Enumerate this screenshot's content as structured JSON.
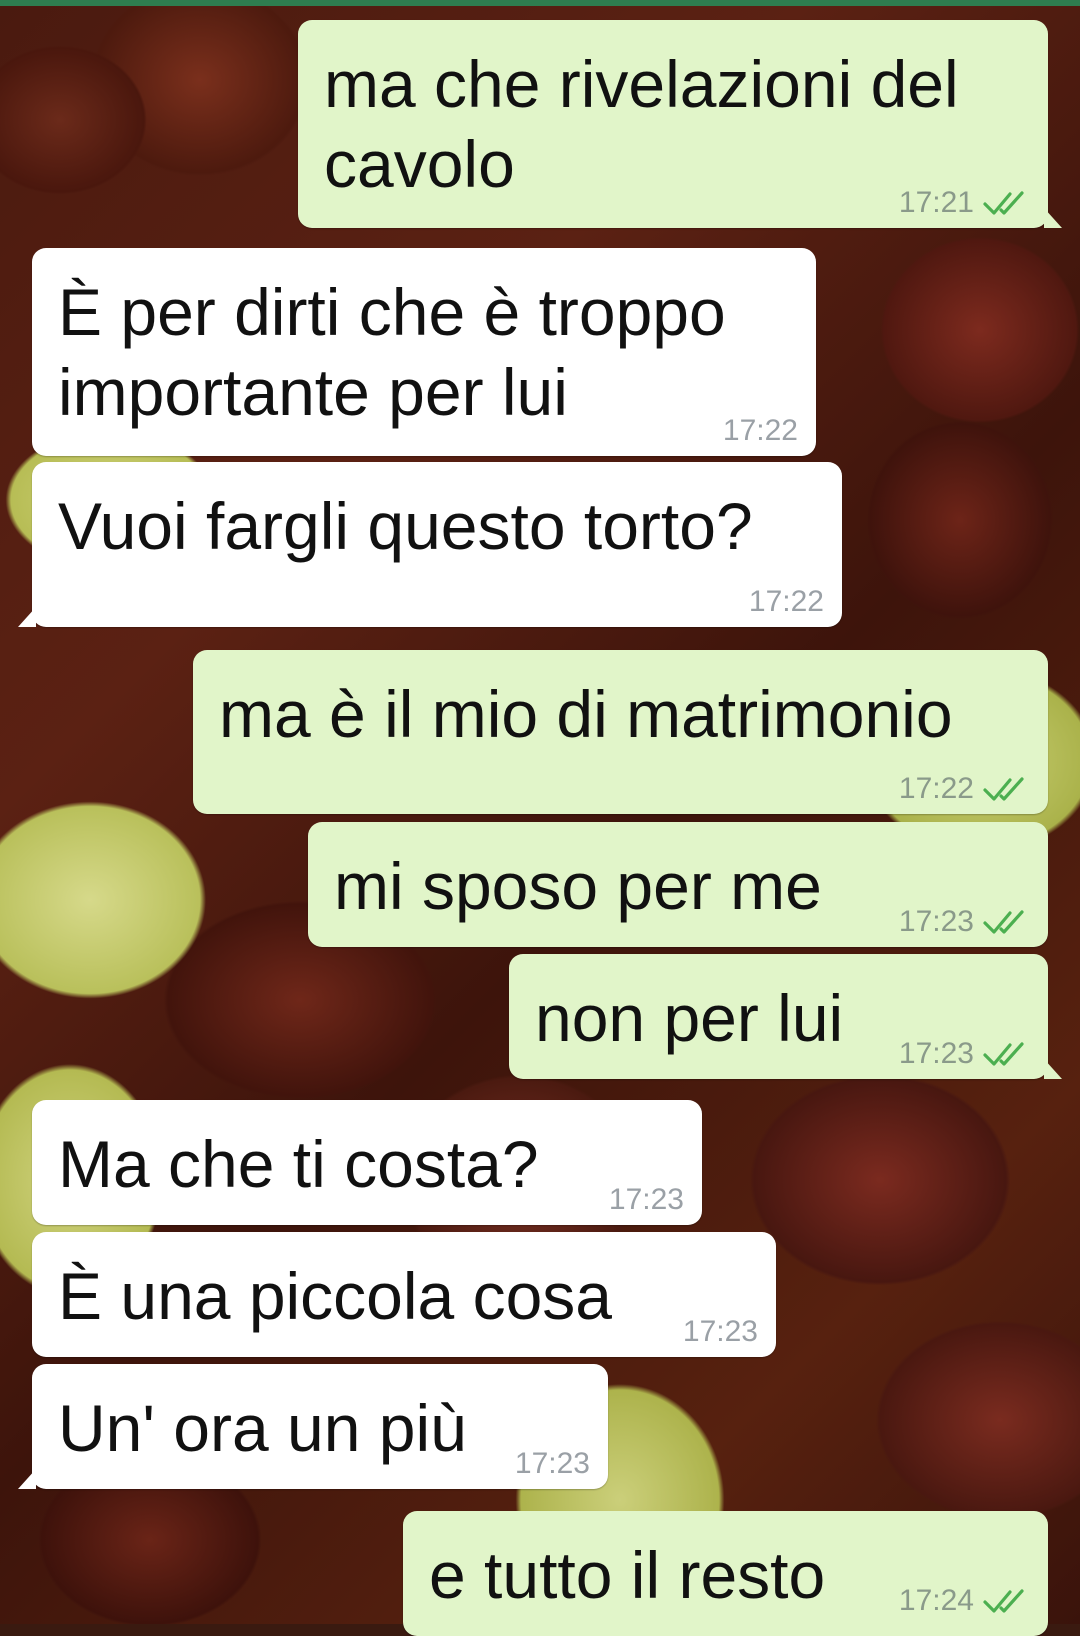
{
  "colors": {
    "outgoing_bubble": "#e1f5c9",
    "incoming_bubble": "#ffffff",
    "read_ticks": "#4caf50",
    "top_strip": "#2e7d4f"
  },
  "icons": {
    "read_status": "double-check-icon"
  },
  "messages": [
    {
      "direction": "outgoing",
      "text": "ma che rivelazioni del\ncavolo",
      "time": "17:21",
      "status": "read"
    },
    {
      "direction": "incoming",
      "text": "È per dirti che è troppo\nimportante per lui",
      "time": "17:22"
    },
    {
      "direction": "incoming",
      "text": "Vuoi fargli questo torto?",
      "time": "17:22"
    },
    {
      "direction": "outgoing",
      "text": "ma è il mio di matrimonio",
      "time": "17:22",
      "status": "read"
    },
    {
      "direction": "outgoing",
      "text": "mi sposo per me",
      "time": "17:23",
      "status": "read"
    },
    {
      "direction": "outgoing",
      "text": "non per lui",
      "time": "17:23",
      "status": "read"
    },
    {
      "direction": "incoming",
      "text": "Ma che ti costa?",
      "time": "17:23"
    },
    {
      "direction": "incoming",
      "text": "È una piccola cosa",
      "time": "17:23"
    },
    {
      "direction": "incoming",
      "text": "Un' ora un più",
      "time": "17:23"
    },
    {
      "direction": "outgoing",
      "text": "e tutto il resto",
      "time": "17:24",
      "status": "read"
    }
  ]
}
